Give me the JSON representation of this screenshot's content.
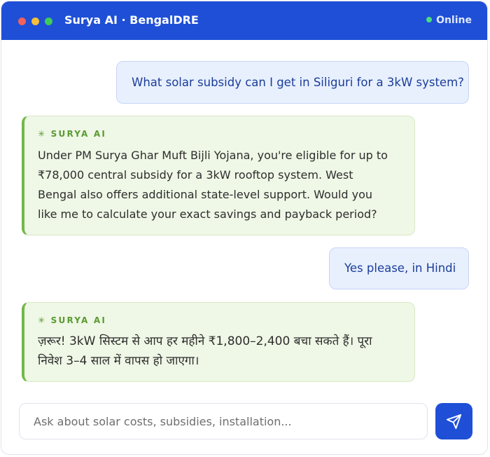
{
  "window": {
    "title": "Surya AI · BengalDRE",
    "status": "Online"
  },
  "messages": [
    {
      "role": "user",
      "text": "What solar subsidy can I get in Siliguri for a 3kW system?"
    },
    {
      "role": "assistant",
      "label": "SURYA AI",
      "lines": [
        "Under PM Surya Ghar Muft Bijli Yojana, you're eligible for up to",
        "₹78,000 central subsidy for a 3kW rooftop system. West",
        "Bengal also offers additional state-level support. Would you",
        "like me to calculate your exact savings and payback period?"
      ]
    },
    {
      "role": "user",
      "text": "Yes please, in Hindi"
    },
    {
      "role": "assistant",
      "label": "SURYA AI",
      "lines": [
        "ज़रूर! 3kW सिस्टम से आप हर महीने ₹1,800–2,400 बचा सकते हैं। पूरा",
        "निवेश 3–4 साल में वापस हो जाएगा।"
      ]
    }
  ],
  "composer": {
    "placeholder": "Ask about solar costs, subsidies, installation..."
  },
  "colors": {
    "header": "#1e4fd6",
    "user_bubble": "#e8f0fe",
    "assistant_bubble": "#eff7e6",
    "assistant_accent": "#73b84a",
    "online": "#4ade80"
  },
  "icons": {
    "assistant_label": "sparkle-icon",
    "send": "send-icon"
  }
}
